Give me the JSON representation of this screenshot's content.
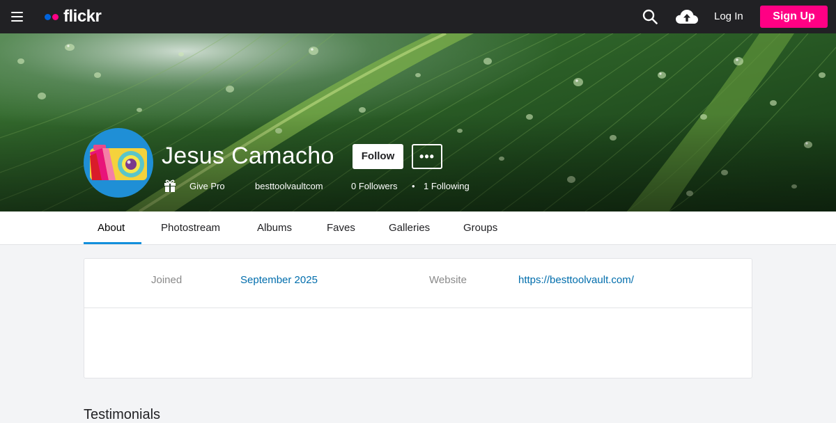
{
  "nav": {
    "logo_text": "flickr",
    "login_label": "Log In",
    "signup_label": "Sign Up"
  },
  "profile": {
    "name": "Jesus Camacho",
    "follow_label": "Follow",
    "more_label": "•••",
    "give_pro_label": "Give Pro",
    "username": "besttoolvaultcom",
    "followers": "0 Followers",
    "separator": "•",
    "following": "1 Following"
  },
  "tabs": [
    {
      "label": "About"
    },
    {
      "label": "Photostream"
    },
    {
      "label": "Albums"
    },
    {
      "label": "Faves"
    },
    {
      "label": "Galleries"
    },
    {
      "label": "Groups"
    }
  ],
  "about": {
    "joined_label": "Joined",
    "joined_value": "September 2025",
    "website_label": "Website",
    "website_value": "https://besttoolvault.com/"
  },
  "sections": {
    "testimonials_title": "Testimonials"
  },
  "colors": {
    "brand_blue": "#0063dc",
    "brand_pink": "#ff0084",
    "link": "#006dac",
    "active_tab": "#128fdc"
  }
}
